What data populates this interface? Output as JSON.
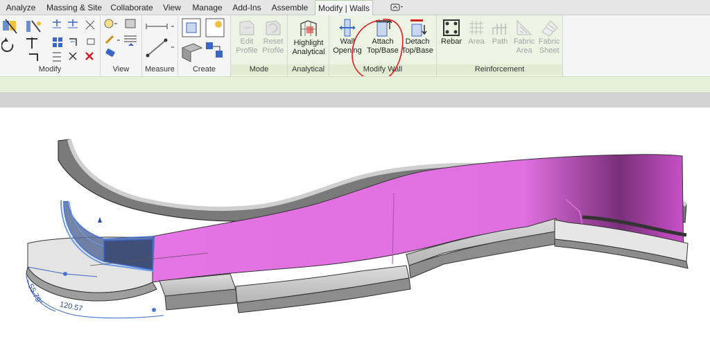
{
  "tabs": [
    {
      "label": "Analyze"
    },
    {
      "label": "Massing & Site"
    },
    {
      "label": "Collaborate"
    },
    {
      "label": "View"
    },
    {
      "label": "Manage"
    },
    {
      "label": "Add-Ins"
    },
    {
      "label": "Assemble"
    },
    {
      "label": "Modify | Walls",
      "active": true
    }
  ],
  "panels": {
    "modify": "Modify",
    "view": "View",
    "measure": "Measure",
    "create": "Create",
    "mode": "Mode",
    "analytical": "Analytical",
    "modify_wall": "Modify Wall",
    "reinforcement": "Reinforcement"
  },
  "tools": {
    "edit_profile": [
      "Edit",
      "Profile"
    ],
    "reset_profile": [
      "Reset",
      "Profile"
    ],
    "highlight_analytical": [
      "Highlight",
      "Analytical"
    ],
    "wall_opening": [
      "Wall",
      "Opening"
    ],
    "attach_top_base": [
      "Attach",
      "Top/Base"
    ],
    "detach_top_base": [
      "Detach",
      "Top/Base"
    ],
    "rebar": [
      "Rebar"
    ],
    "area": [
      "Area"
    ],
    "path": [
      "Path"
    ],
    "fabric_area": [
      "Fabric",
      "Area"
    ],
    "fabric_sheet": [
      "Fabric",
      "Sheet"
    ]
  },
  "dimensions": {
    "angle_label": "55.79°",
    "arc_label": "120.57"
  },
  "colors": {
    "wall_magenta": "#e474e4",
    "selection_blue": "#3a66c8",
    "annotation_red": "#e01b1b",
    "context_green": "#e7f0d9"
  }
}
